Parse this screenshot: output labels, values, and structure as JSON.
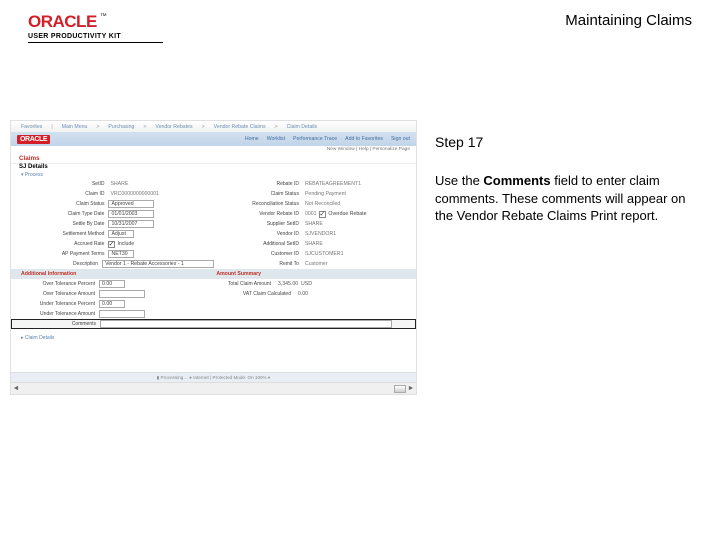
{
  "header": {
    "logo_text": "ORACLE",
    "upk": "USER PRODUCTIVITY KIT",
    "title": "Maintaining Claims"
  },
  "right": {
    "step": "Step 17",
    "intro_pre": "Use the ",
    "intro_bold": "Comments",
    "intro_post": " field to enter claim comments. These comments will appear on the Vendor Rebate Claims Print report."
  },
  "shot": {
    "nav_items": [
      "Favorites",
      "Main Menu",
      "Purchasing",
      "Vendor Rebates",
      "Vendor Rebate Claims",
      "Claim Details"
    ],
    "blue_links": [
      "Home",
      "Worklist",
      "Performance Trace",
      "Add to Favorites",
      "Sign out"
    ],
    "oracle": "ORACLE",
    "user_line": "New Window | Help | Personalize Page",
    "section_1": "Claims",
    "unit_label": "SJ Details",
    "process": "Process",
    "left_form": [
      {
        "l": "SetID",
        "v": "SHARE"
      },
      {
        "l": "Claim ID",
        "v": "VRC0000000000001"
      },
      {
        "l": "Claim Status",
        "inp": "Approved",
        "w": "w30"
      },
      {
        "l": "Claim Type Date",
        "inp": "01/01/2003",
        "w": "w30"
      },
      {
        "l": "Settle By Date",
        "inp": "10/31/2007",
        "w": "w30"
      },
      {
        "l": "Settlement Method",
        "inp": "Adjust",
        "w": "w20"
      },
      {
        "l": "Accrued Rate",
        "check": true,
        "cklabel": "Include"
      },
      {
        "l": "AP Payment Terms",
        "inp": "NET30",
        "w": "w20"
      },
      {
        "l": "Description",
        "inp": "Vendor 1 - Rebate Accessories - 1",
        "w": "w80"
      }
    ],
    "right_form": [
      {
        "l": "Rebate ID",
        "v": "REBATEAGREEMENT1"
      },
      {
        "l": "Claim Status",
        "v": "Pending Payment"
      },
      {
        "l": "Reconciliation Status",
        "v": "Not Reconciled"
      },
      {
        "l": "Vendor Rebate ID",
        "v": "0001",
        "ck": true,
        "cklabel": "Overdue Rebate"
      },
      {
        "l": "Supplier SetID",
        "v": "SHARE"
      },
      {
        "l": "Vendor ID",
        "v": "SJVENDOR1"
      },
      {
        "l": "Additional SetID",
        "v": "SHARE"
      },
      {
        "l": "Customer ID",
        "v": "SJCUSTOMER1"
      },
      {
        "l": "Remit To",
        "v": "Customer"
      }
    ],
    "bar1": "Additional Information",
    "bar2": "Amount Summary",
    "amounts": [
      {
        "l1": "Over Tolerance Percent",
        "v1": "0.00",
        "l2": "Total Claim Amount",
        "v2": "3,345.00",
        "cur": "USD"
      },
      {
        "l1": "Over Tolerance Amount",
        "v1": "",
        "l2": "VAT Claim Calculated",
        "v2": "0.00"
      },
      {
        "l1": "Under Tolerance Percent",
        "v1": "0.00"
      },
      {
        "l1": "Under Tolerance Amount",
        "v1": ""
      },
      {
        "l1": "Comments",
        "wide": true
      }
    ],
    "claim_details": "Claim Details",
    "bottom_bar": "▮  Processing…  ●  Internet | Protected Mode: On      100%  ▾"
  }
}
